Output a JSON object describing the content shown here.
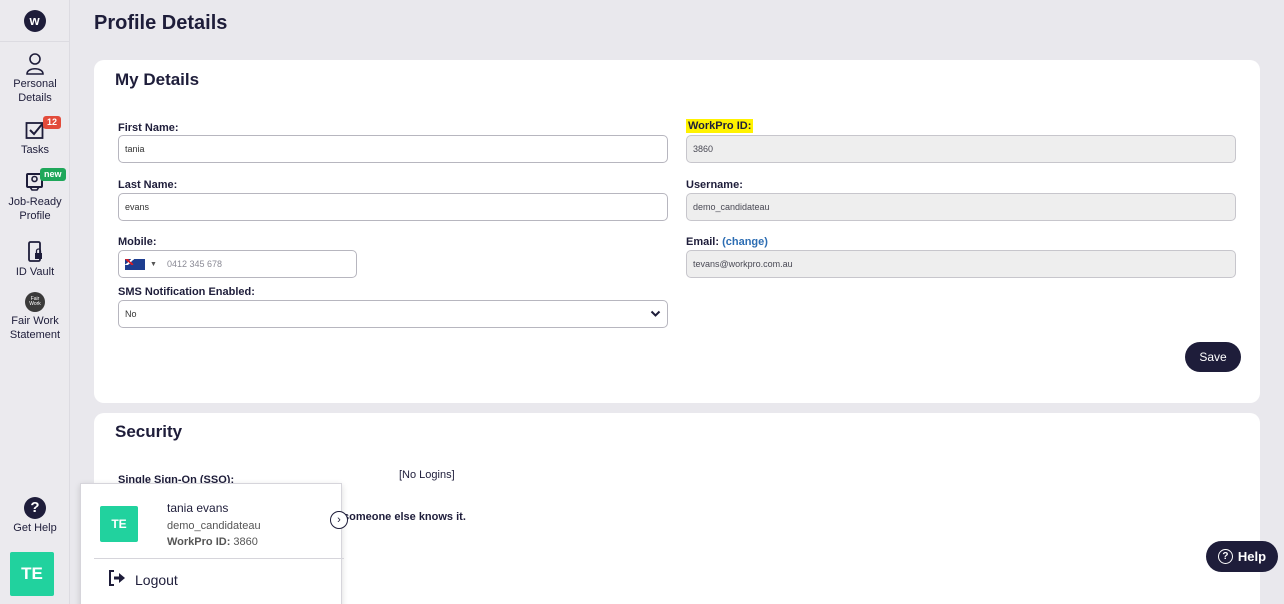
{
  "sidebar": {
    "logo": "w",
    "items": [
      {
        "icon": "person-icon",
        "label": "Personal Details"
      },
      {
        "icon": "tasks-icon",
        "label": "Tasks",
        "badge": "12"
      },
      {
        "icon": "job-ready-icon",
        "label": "Job-Ready Profile",
        "badge": "new"
      },
      {
        "icon": "id-vault-icon",
        "label": "ID Vault"
      },
      {
        "icon": "fair-work-icon",
        "label": "Fair Work Statement",
        "icon_text": "Fair Work"
      }
    ],
    "help": {
      "icon": "?",
      "label": "Get Help"
    },
    "avatar": "TE"
  },
  "page": {
    "title": "Profile Details"
  },
  "my_details": {
    "title": "My Details",
    "first_name": {
      "label": "First Name:",
      "value": "tania"
    },
    "last_name": {
      "label": "Last Name:",
      "value": "evans"
    },
    "mobile": {
      "label": "Mobile:",
      "placeholder": "0412 345 678"
    },
    "sms": {
      "label": "SMS Notification Enabled:",
      "value": "No"
    },
    "workpro_id": {
      "label": "WorkPro ID:",
      "value": "3860"
    },
    "username": {
      "label": "Username:",
      "value": "demo_candidateau"
    },
    "email": {
      "label": "Email:",
      "change_link": "(change)",
      "value": "tevans@workpro.com.au"
    },
    "save_label": "Save"
  },
  "security": {
    "title": "Security",
    "sso_label": "Single Sign-On (SSO):",
    "sso_value": "[No Logins]",
    "partial_text": "someone else knows it."
  },
  "popup": {
    "avatar": "TE",
    "name": "tania evans",
    "username": "demo_candidateau",
    "workpro_id_label": "WorkPro ID:",
    "workpro_id_value": "3860",
    "logout_label": "Logout"
  },
  "help_button": {
    "label": "Help"
  },
  "colors": {
    "navy": "#1e1d3a",
    "teal": "#21d29e",
    "highlight": "#fff200",
    "red_badge": "#e24b3b",
    "green_badge": "#1fa75a"
  }
}
